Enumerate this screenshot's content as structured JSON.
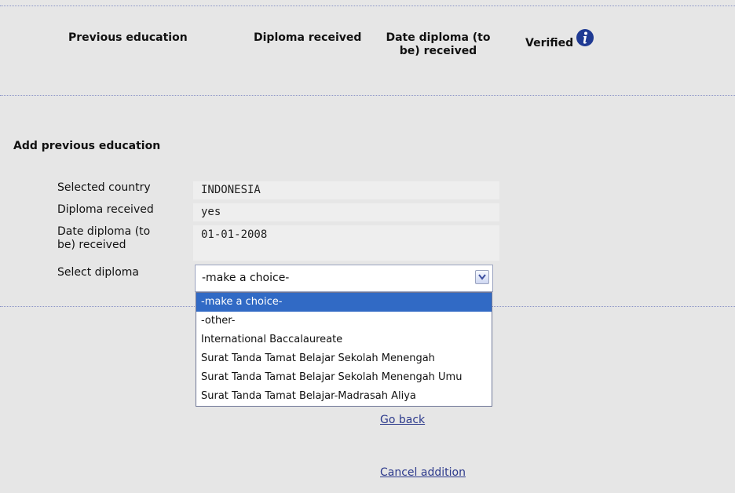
{
  "table_header": {
    "previous_education": "Previous education",
    "diploma_received": "Diploma received",
    "date_diploma_line1": "Date diploma (to",
    "date_diploma_line2": "be) received",
    "verified": "Verified"
  },
  "section": {
    "title": "Add previous education"
  },
  "form": {
    "selected_country_label": "Selected country",
    "selected_country_value": "INDONESIA",
    "diploma_received_label": "Diploma received",
    "diploma_received_value": "yes",
    "date_label_line1": "Date diploma (to",
    "date_label_line2": "be) received",
    "date_value": "01-01-2008",
    "select_diploma_label": "Select diploma",
    "select_diploma_value": "-make a choice-"
  },
  "dropdown": {
    "options": [
      "-make a choice-",
      "-other-",
      "International Baccalaureate",
      "Surat Tanda Tamat Belajar Sekolah Menengah",
      "Surat Tanda Tamat Belajar Sekolah Menengah Umu",
      "Surat Tanda Tamat Belajar-Madrasah Aliya"
    ]
  },
  "links": {
    "go_back": "Go back",
    "cancel_addition": "Cancel addition"
  },
  "icons": {
    "info": "info-icon",
    "dropdown": "chevron-down-icon"
  },
  "colors": {
    "background": "#e6e6e6",
    "selection": "#316ac5",
    "info_icon": "#1f3a93",
    "link": "#2d3a8c"
  }
}
